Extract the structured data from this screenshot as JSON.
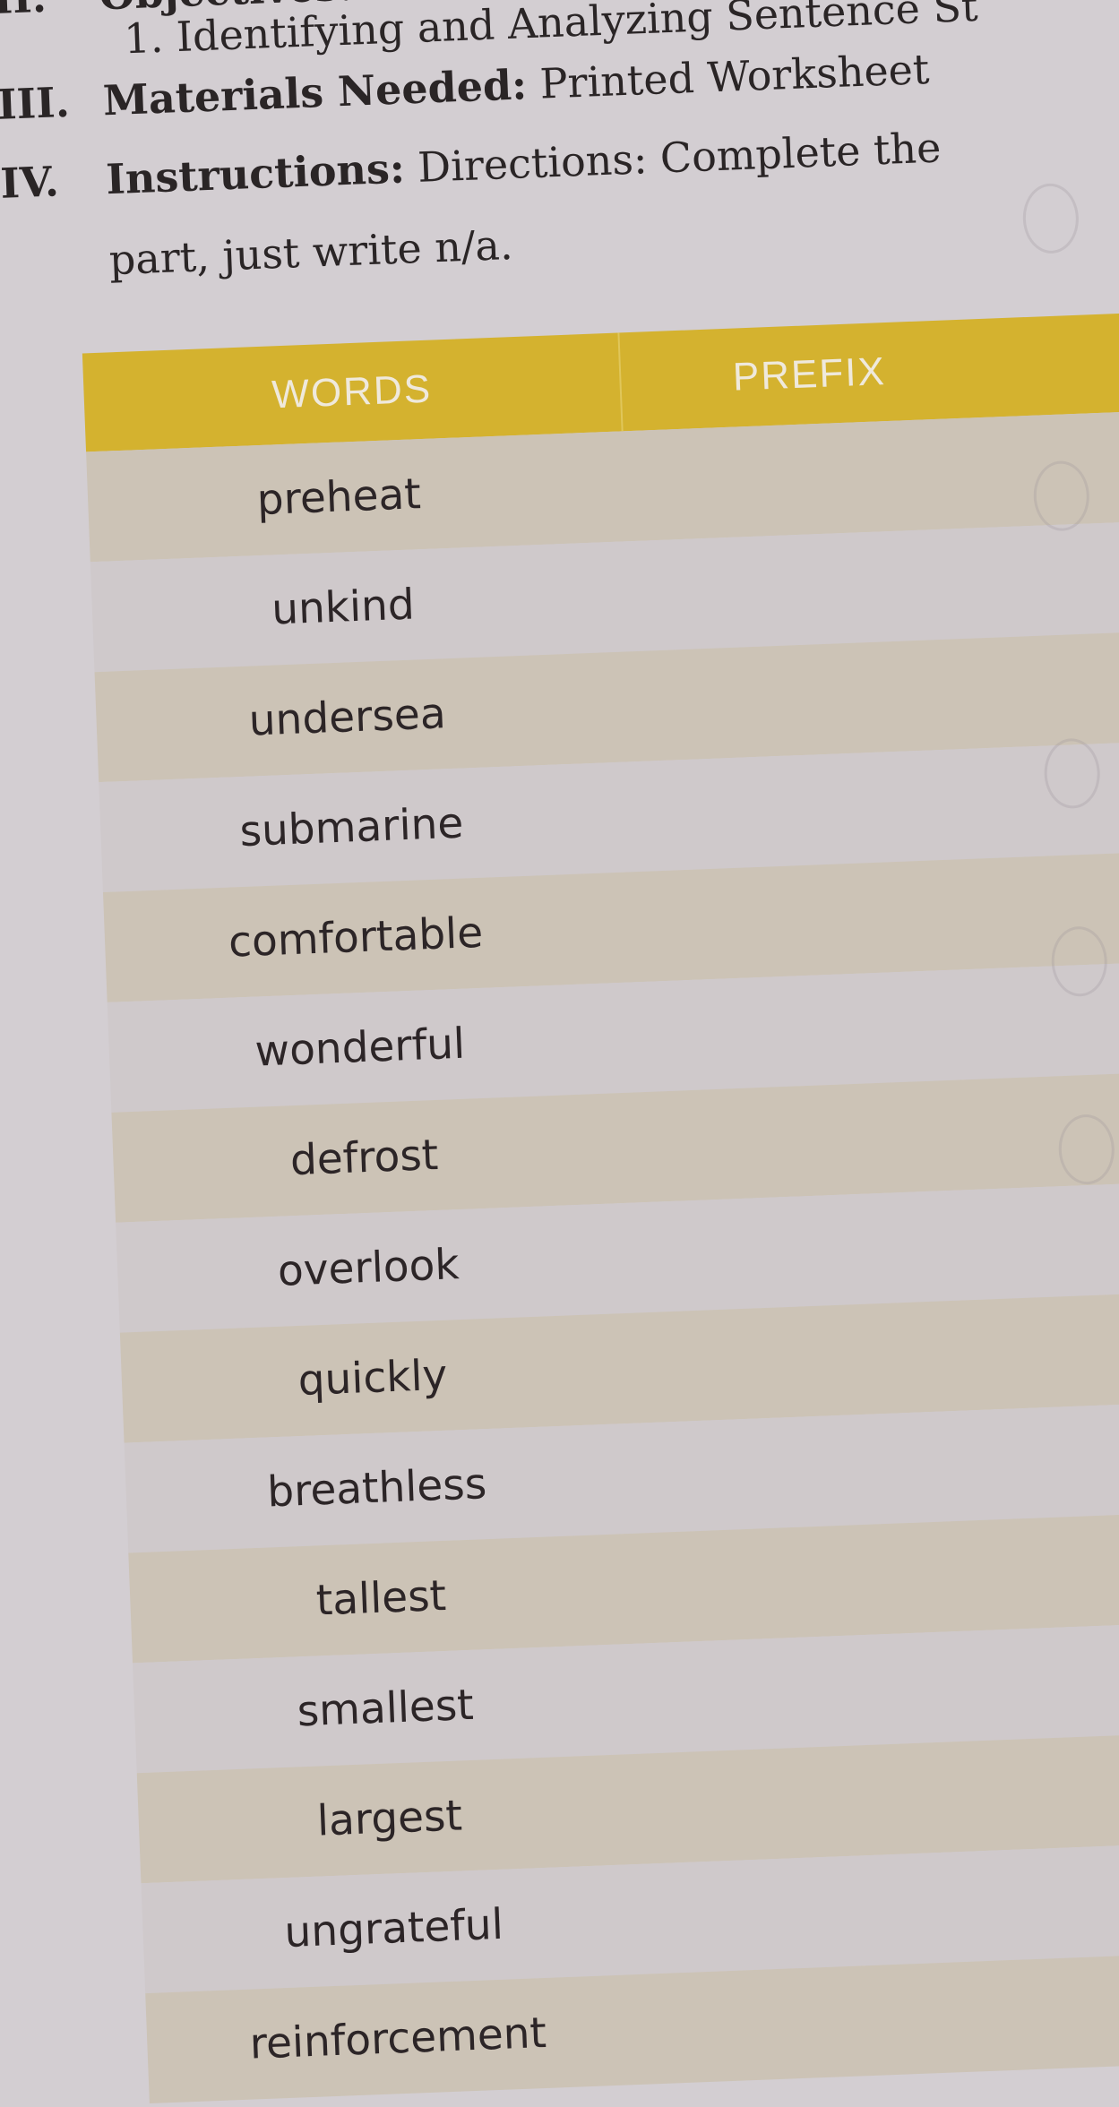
{
  "document": {
    "sections": [
      {
        "numeral": "II.",
        "label": "Objectives:",
        "text": ""
      },
      {
        "numeral": "",
        "label": "",
        "text": "1. Identifying and Analyzing Sentence St"
      },
      {
        "numeral": "III.",
        "label": "Materials Needed:",
        "text": " Printed Worksheet"
      },
      {
        "numeral": "IV.",
        "label": "Instructions:",
        "text": " Directions: Complete the"
      },
      {
        "numeral": "",
        "label": "",
        "text": "part, just write n/a."
      }
    ]
  },
  "table": {
    "header_color": "#d4b22f",
    "columns": [
      "WORDS",
      "PREFIX"
    ],
    "rows": [
      {
        "word": "preheat",
        "prefix": ""
      },
      {
        "word": "unkind",
        "prefix": ""
      },
      {
        "word": "undersea",
        "prefix": ""
      },
      {
        "word": "submarine",
        "prefix": ""
      },
      {
        "word": "comfortable",
        "prefix": ""
      },
      {
        "word": "wonderful",
        "prefix": ""
      },
      {
        "word": "defrost",
        "prefix": ""
      },
      {
        "word": "overlook",
        "prefix": ""
      },
      {
        "word": "quickly",
        "prefix": ""
      },
      {
        "word": "breathless",
        "prefix": ""
      },
      {
        "word": "tallest",
        "prefix": ""
      },
      {
        "word": "smallest",
        "prefix": ""
      },
      {
        "word": "largest",
        "prefix": ""
      },
      {
        "word": "ungrateful",
        "prefix": ""
      },
      {
        "word": "reinforcement",
        "prefix": ""
      }
    ]
  }
}
